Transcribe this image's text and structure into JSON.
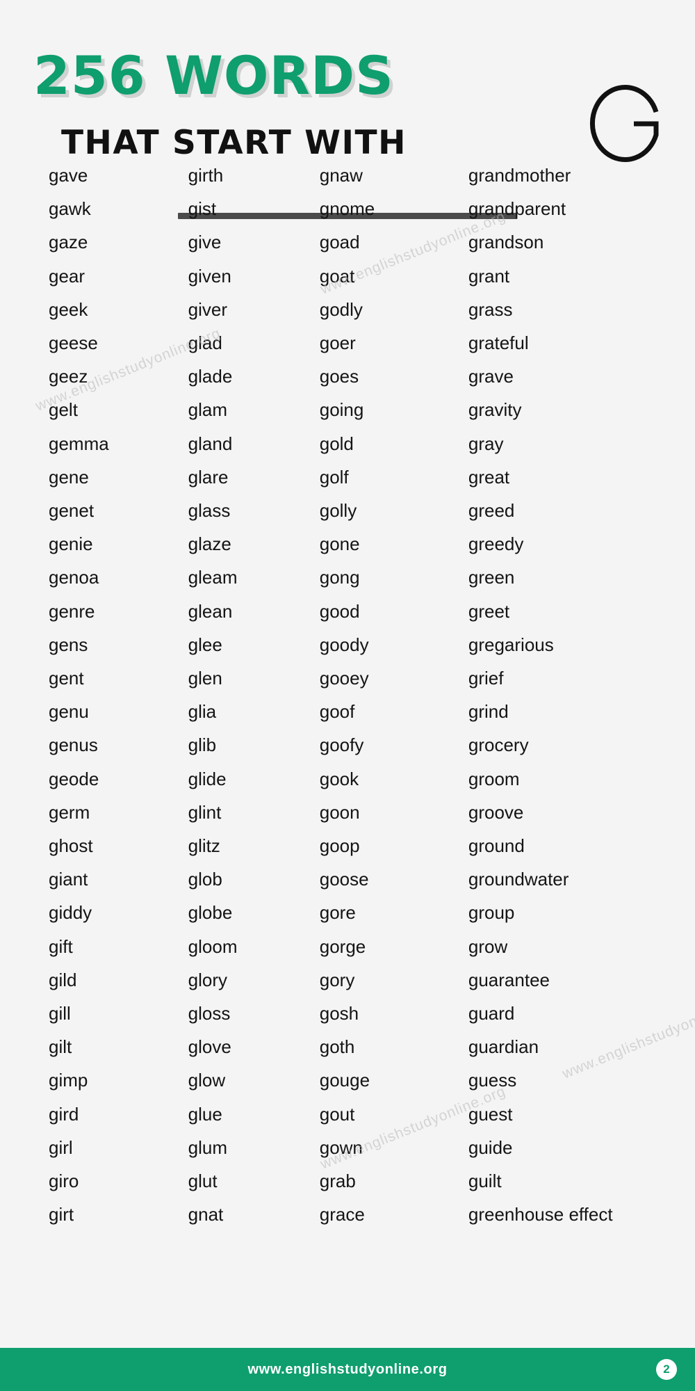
{
  "header": {
    "main_title": "256 WORDS",
    "sub_title": "THAT START WITH",
    "big_letter": "G",
    "accent_color": "#0f9e6e",
    "title_shadow_color": "#cfd2d1"
  },
  "watermarks": [
    "www.englishstudyonline.org",
    "www.englishstudyonline.org",
    "www.englishstudyonline.org",
    "www.englishstudyonline.org"
  ],
  "columns": [
    {
      "index": 1,
      "words": [
        "gave",
        "gawk",
        "gaze",
        "gear",
        "geek",
        "geese",
        "geez",
        "gelt",
        "gemma",
        "gene",
        "genet",
        "genie",
        "genoa",
        "genre",
        "gens",
        "gent",
        "genu",
        "genus",
        "geode",
        "germ",
        "ghost",
        "giant",
        "giddy",
        "gift",
        "gild",
        "gill",
        "gilt",
        "gimp",
        "gird",
        "girl",
        "giro",
        "girt"
      ]
    },
    {
      "index": 2,
      "words": [
        "girth",
        "gist",
        "give",
        "given",
        "giver",
        "glad",
        "glade",
        "glam",
        "gland",
        "glare",
        "glass",
        "glaze",
        "gleam",
        "glean",
        "glee",
        "glen",
        "glia",
        "glib",
        "glide",
        "glint",
        "glitz",
        "glob",
        "globe",
        "gloom",
        "glory",
        "gloss",
        "glove",
        "glow",
        "glue",
        "glum",
        "glut",
        "gnat"
      ]
    },
    {
      "index": 3,
      "words": [
        "gnaw",
        "gnome",
        "goad",
        "goat",
        "godly",
        "goer",
        "goes",
        "going",
        "gold",
        "golf",
        "golly",
        "gone",
        "gong",
        "good",
        "goody",
        "gooey",
        "goof",
        "goofy",
        "gook",
        "goon",
        "goop",
        "goose",
        "gore",
        "gorge",
        "gory",
        "gosh",
        "goth",
        "gouge",
        "gout",
        "gown",
        "grab",
        "grace"
      ]
    },
    {
      "index": 4,
      "words": [
        "grandmother",
        "grandparent",
        "grandson",
        "grant",
        "grass",
        "grateful",
        "grave",
        "gravity",
        "gray",
        "great",
        "greed",
        "greedy",
        "green",
        "greet",
        "gregarious",
        "grief",
        "grind",
        "grocery",
        "groom",
        "groove",
        "ground",
        "groundwater",
        "group",
        "grow",
        "guarantee",
        "guard",
        "guardian",
        "guess",
        "guest",
        "guide",
        "guilt",
        "greenhouse effect"
      ]
    }
  ],
  "footer": {
    "url": "www.englishstudyonline.org",
    "page_number": "2",
    "background_color": "#0f9e6e"
  }
}
